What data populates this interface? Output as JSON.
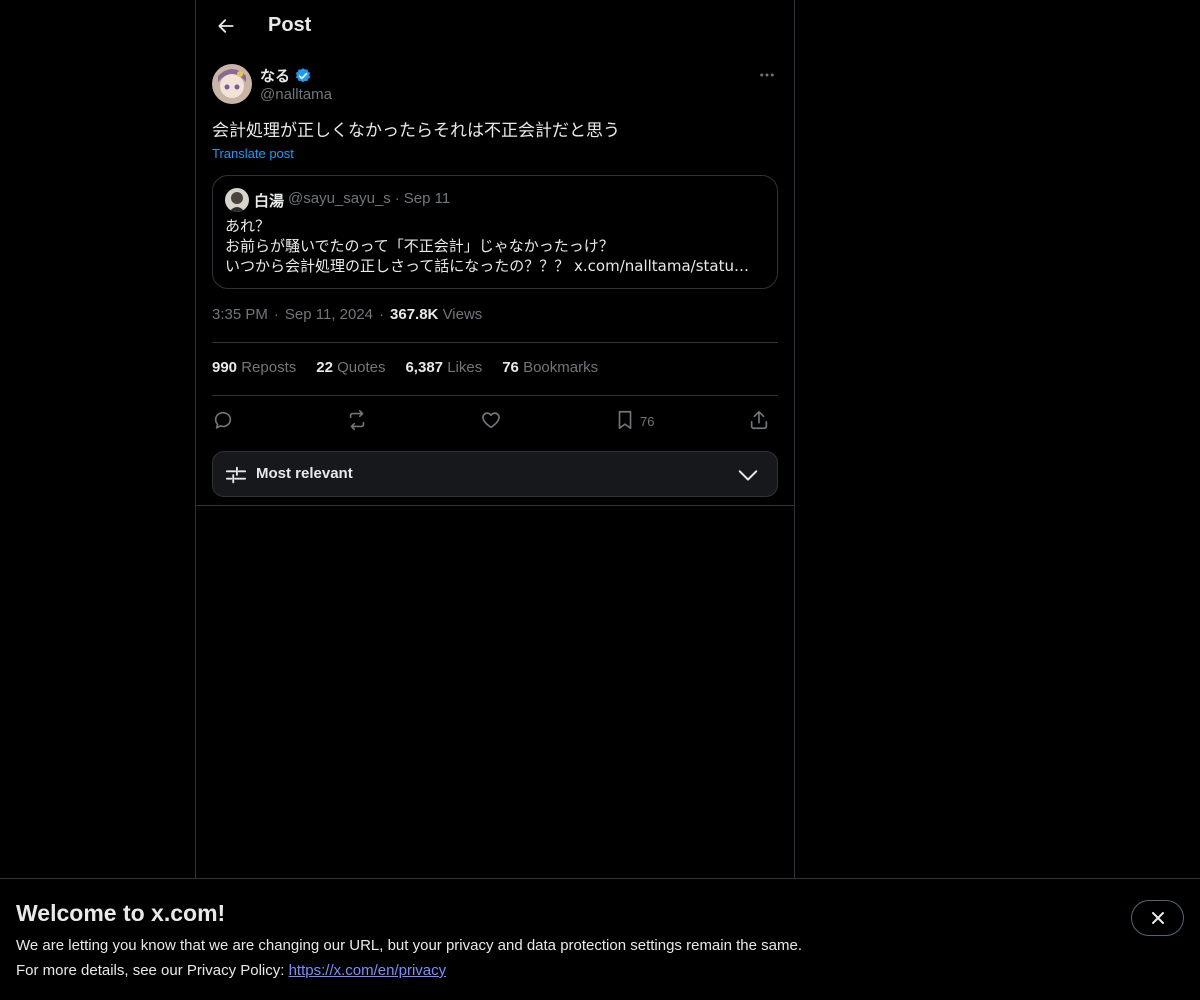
{
  "header": {
    "title": "Post"
  },
  "post": {
    "author_name": "なる",
    "author_handle": "@nalltama",
    "text": "会計処理が正しくなかったらそれは不正会計だと思う",
    "translate_label": "Translate post",
    "time": "3:35 PM",
    "date": "Sep 11, 2024",
    "views_count": "367.8K",
    "views_label": "Views",
    "separator": "·"
  },
  "quote": {
    "name": "白湯",
    "handle": "@sayu_sayu_s",
    "separator": "·",
    "date": "Sep 11",
    "lines": [
      "あれ？",
      "お前らが騒いでたのって「不正会計」じゃなかったっけ？",
      "いつから会計処理の正しさって話になったの？？？ x.com/nalltama/statu…"
    ]
  },
  "stats": [
    {
      "count": "990",
      "label": "Reposts"
    },
    {
      "count": "22",
      "label": "Quotes"
    },
    {
      "count": "6,387",
      "label": "Likes"
    },
    {
      "count": "76",
      "label": "Bookmarks"
    }
  ],
  "actions": {
    "bookmark_count": "76"
  },
  "sort": {
    "label": "Most relevant"
  },
  "banner": {
    "title": "Welcome to x.com!",
    "line1": "We are letting you know that we are changing our URL, but your privacy and data protection settings remain the same.",
    "line2_prefix": "For more details, see our Privacy Policy: ",
    "link": "https://x.com/en/privacy"
  },
  "colors": {
    "accent": "#1d9bf0",
    "muted": "#71767b",
    "border": "#2f3336",
    "link": "#7d8cff"
  }
}
